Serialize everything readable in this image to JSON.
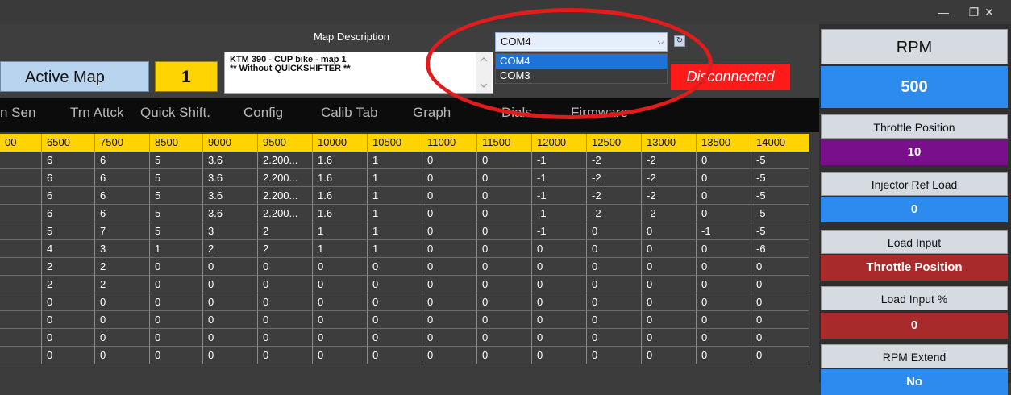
{
  "window": {
    "minimize": "—",
    "maximize": "❐",
    "close": "✕"
  },
  "active_map": {
    "label": "Active Map",
    "value": "1"
  },
  "map_description": {
    "label": "Map Description",
    "text": "KTM 390 - CUP bike - map 1\n** Without QUICKSHIFTER **"
  },
  "port": {
    "selected": "COM4",
    "options": [
      "COM4",
      "COM3"
    ],
    "refresh_icon": "refresh-icon"
  },
  "status": {
    "text": "Disconnected",
    "color": "#ff1a1a"
  },
  "tabs": [
    "n Sen",
    "Trn Attck",
    "Quick Shift.",
    "Config",
    "Calib Tab",
    "Graph",
    "Dials",
    "Firmware"
  ],
  "table": {
    "headers": [
      "00",
      "6500",
      "7500",
      "8500",
      "9000",
      "9500",
      "10000",
      "10500",
      "11000",
      "11500",
      "12000",
      "12500",
      "13000",
      "13500",
      "14000"
    ],
    "rows": [
      [
        "",
        "6",
        "6",
        "5",
        "3.6",
        "2.200...",
        "1.6",
        "1",
        "0",
        "0",
        "-1",
        "-2",
        "-2",
        "0",
        "-5"
      ],
      [
        "",
        "6",
        "6",
        "5",
        "3.6",
        "2.200...",
        "1.6",
        "1",
        "0",
        "0",
        "-1",
        "-2",
        "-2",
        "0",
        "-5"
      ],
      [
        "",
        "6",
        "6",
        "5",
        "3.6",
        "2.200...",
        "1.6",
        "1",
        "0",
        "0",
        "-1",
        "-2",
        "-2",
        "0",
        "-5"
      ],
      [
        "",
        "6",
        "6",
        "5",
        "3.6",
        "2.200...",
        "1.6",
        "1",
        "0",
        "0",
        "-1",
        "-2",
        "-2",
        "0",
        "-5"
      ],
      [
        "",
        "5",
        "7",
        "5",
        "3",
        "2",
        "1",
        "1",
        "0",
        "0",
        "-1",
        "0",
        "0",
        "-1",
        "-5"
      ],
      [
        "",
        "4",
        "3",
        "1",
        "2",
        "2",
        "1",
        "1",
        "0",
        "0",
        "0",
        "0",
        "0",
        "0",
        "-6"
      ],
      [
        "",
        "2",
        "2",
        "0",
        "0",
        "0",
        "0",
        "0",
        "0",
        "0",
        "0",
        "0",
        "0",
        "0",
        "0"
      ],
      [
        "",
        "2",
        "2",
        "0",
        "0",
        "0",
        "0",
        "0",
        "0",
        "0",
        "0",
        "0",
        "0",
        "0",
        "0"
      ],
      [
        "",
        "0",
        "0",
        "0",
        "0",
        "0",
        "0",
        "0",
        "0",
        "0",
        "0",
        "0",
        "0",
        "0",
        "0"
      ],
      [
        "",
        "0",
        "0",
        "0",
        "0",
        "0",
        "0",
        "0",
        "0",
        "0",
        "0",
        "0",
        "0",
        "0",
        "0"
      ],
      [
        "",
        "0",
        "0",
        "0",
        "0",
        "0",
        "0",
        "0",
        "0",
        "0",
        "0",
        "0",
        "0",
        "0",
        "0"
      ],
      [
        "",
        "0",
        "0",
        "0",
        "0",
        "0",
        "0",
        "0",
        "0",
        "0",
        "0",
        "0",
        "0",
        "0",
        "0"
      ]
    ]
  },
  "gauges": {
    "rpm": {
      "label": "RPM",
      "value": "500",
      "color": "#2d8bf0"
    },
    "throttle_position": {
      "label": "Throttle Position",
      "value": "10",
      "color": "#7a0f8c"
    },
    "injector_ref_load": {
      "label": "Injector Ref Load",
      "value": "0",
      "color": "#2d8bf0"
    },
    "load_input": {
      "label": "Load Input",
      "value": "Throttle Position",
      "color": "#a82a2a"
    },
    "load_input_pct": {
      "label": "Load Input %",
      "value": "0",
      "color": "#a82a2a"
    },
    "rpm_extend": {
      "label": "RPM Extend",
      "value": "No",
      "color": "#2d8bf0"
    }
  }
}
